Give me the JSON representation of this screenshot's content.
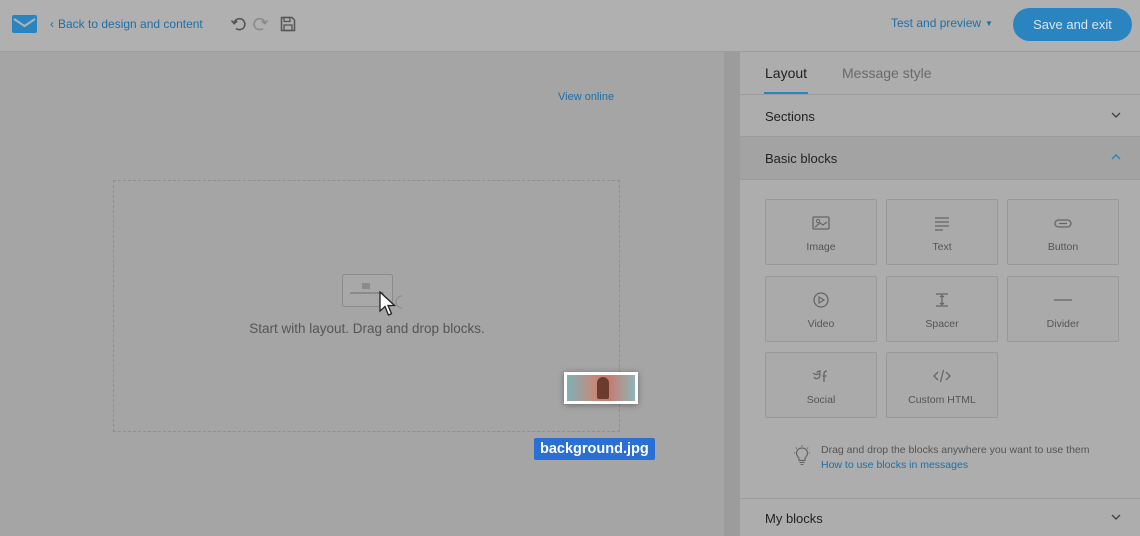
{
  "topbar": {
    "back_label": "Back to design and content",
    "test_preview_label": "Test and preview",
    "save_exit_label": "Save and exit"
  },
  "canvas": {
    "view_online": "View online",
    "dropzone_text": "Start with layout. Drag and drop blocks.",
    "dragged_file": "background.jpg"
  },
  "panel": {
    "tabs": [
      {
        "label": "Layout",
        "active": true
      },
      {
        "label": "Message style",
        "active": false
      }
    ],
    "sections_label": "Sections",
    "basic_blocks_label": "Basic blocks",
    "blocks": [
      {
        "label": "Image",
        "icon": "image-icon"
      },
      {
        "label": "Text",
        "icon": "text-icon"
      },
      {
        "label": "Button",
        "icon": "button-icon"
      },
      {
        "label": "Video",
        "icon": "video-icon"
      },
      {
        "label": "Spacer",
        "icon": "spacer-icon"
      },
      {
        "label": "Divider",
        "icon": "divider-icon"
      },
      {
        "label": "Social",
        "icon": "social-icon"
      },
      {
        "label": "Custom HTML",
        "icon": "code-icon"
      }
    ],
    "hint_text": "Drag and drop the blocks anywhere you want to use them",
    "hint_link": "How to use blocks in messages",
    "my_blocks_label": "My blocks"
  },
  "colors": {
    "accent": "#2a84c0",
    "link": "#1f6fa8",
    "drag_label": "#2a6fd6"
  }
}
